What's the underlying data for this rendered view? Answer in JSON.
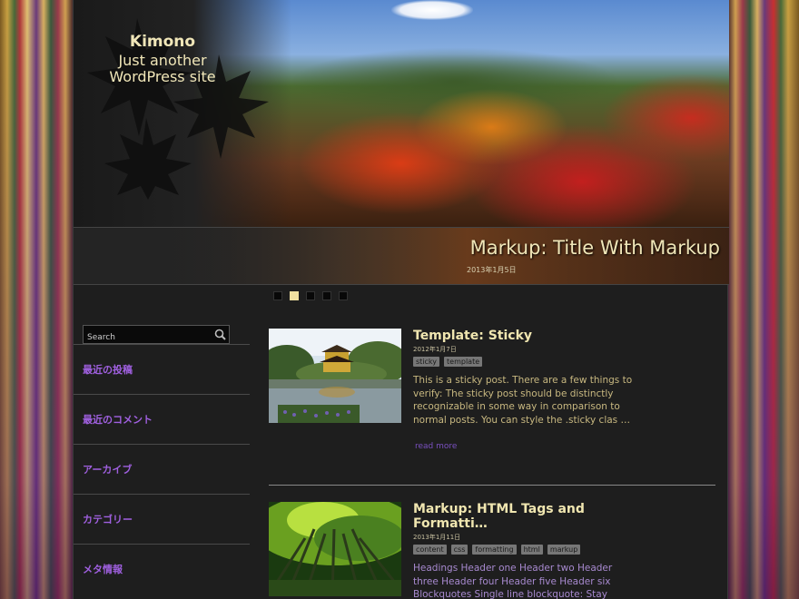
{
  "site": {
    "title": "Kimono",
    "description": "Just another WordPress site"
  },
  "slider": {
    "title": "Markup: Title With Markup",
    "date": "2013年1月5日",
    "dots": 5,
    "active_dot": 2
  },
  "sidebar": {
    "search_placeholder": "Search",
    "widgets": [
      {
        "label": "最近の投稿"
      },
      {
        "label": "最近のコメント"
      },
      {
        "label": "アーカイブ"
      },
      {
        "label": "カテゴリー"
      },
      {
        "label": "メタ情報"
      }
    ]
  },
  "posts": [
    {
      "title": "Template: Sticky",
      "date": "2012年1月7日",
      "tags": [
        "sticky",
        "template"
      ],
      "excerpt": "This is a sticky post. There are a few things to verify: The sticky post should be distinctly recognizable in some way in comparison to normal posts. You can style the .sticky clas …",
      "read_more": "read more"
    },
    {
      "title": "Markup: HTML Tags and Formatti…",
      "date": "2013年1月11日",
      "tags": [
        "content",
        "css",
        "formatting",
        "html",
        "markup"
      ],
      "excerpt": "Headings Header one Header two Header three Header four Header five Header six Blockquotes Single line blockquote: Stay"
    }
  ],
  "colors": {
    "accent_purple": "#a060e0",
    "title_cream": "#f0e6b8",
    "background": "#1e1e1e"
  }
}
